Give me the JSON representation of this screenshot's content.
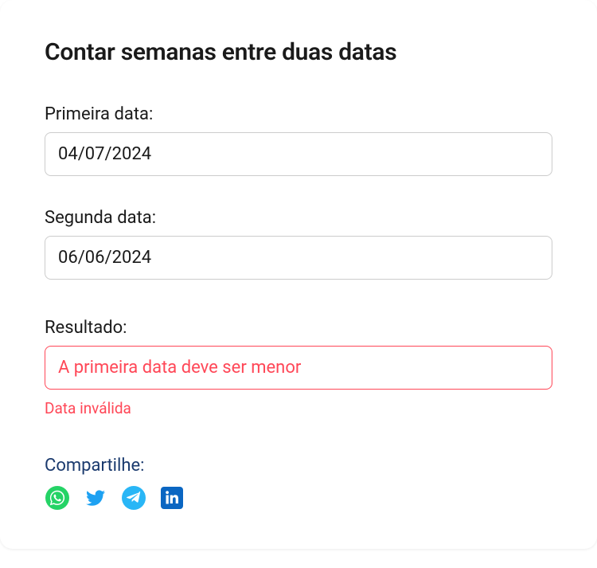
{
  "title": "Contar semanas entre duas datas",
  "fields": {
    "first_date": {
      "label": "Primeira data:",
      "value": "04/07/2024"
    },
    "second_date": {
      "label": "Segunda data:",
      "value": "06/06/2024"
    }
  },
  "result": {
    "label": "Resultado:",
    "message": "A primeira data deve ser menor",
    "error": "Data inválida"
  },
  "share": {
    "label": "Compartilhe:"
  }
}
